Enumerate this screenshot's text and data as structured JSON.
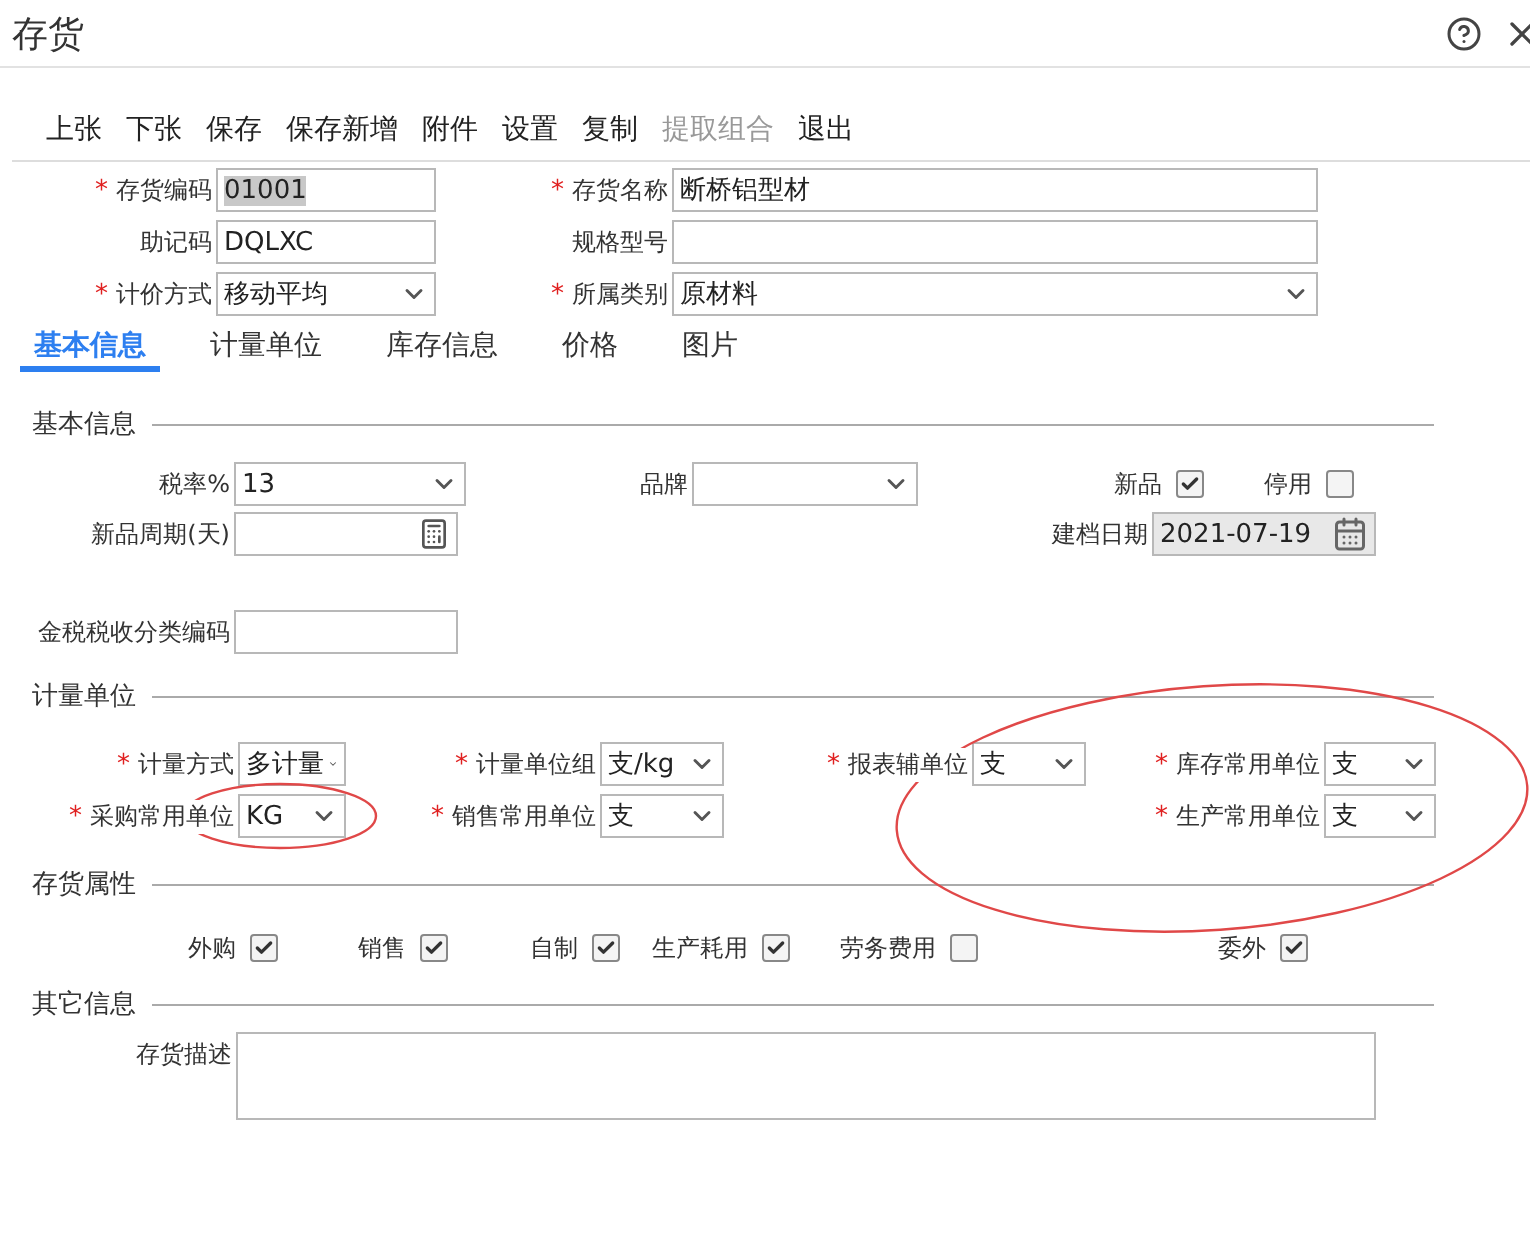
{
  "window": {
    "title": "存货"
  },
  "toolbar": [
    {
      "label": "上张",
      "disabled": false
    },
    {
      "label": "下张",
      "disabled": false
    },
    {
      "label": "保存",
      "disabled": false
    },
    {
      "label": "保存新增",
      "disabled": false
    },
    {
      "label": "附件",
      "disabled": false
    },
    {
      "label": "设置",
      "disabled": false
    },
    {
      "label": "复制",
      "disabled": false
    },
    {
      "label": "提取组合",
      "disabled": true
    },
    {
      "label": "退出",
      "disabled": false
    }
  ],
  "header_rows": [
    [
      {
        "label": "存货编码",
        "asterisk": "*",
        "kind": "text",
        "value": "01001",
        "text_selected": true
      },
      {
        "label": "存货名称",
        "asterisk": "*",
        "kind": "text",
        "value": "断桥铝型材"
      }
    ],
    [
      {
        "label": "助记码",
        "kind": "text",
        "value": "DQLXC"
      },
      {
        "label": "规格型号",
        "kind": "text"
      }
    ],
    [
      {
        "label": "计价方式",
        "asterisk": "*",
        "kind": "select",
        "value": "移动平均"
      },
      {
        "label": "所属类别",
        "asterisk": "*",
        "kind": "select",
        "value": "原材料"
      }
    ]
  ],
  "tabs": [
    {
      "label": "基本信息",
      "selected": true
    },
    {
      "label": "计量单位",
      "selected": false
    },
    {
      "label": "库存信息",
      "selected": false
    },
    {
      "label": "价格",
      "selected": false
    },
    {
      "label": "图片",
      "selected": false
    }
  ],
  "sections": [
    {
      "title": "基本信息",
      "rows": [
        [
          {
            "label": "税率%",
            "kind": "select",
            "value": "13"
          },
          {
            "label": "品牌",
            "kind": "select"
          },
          {
            "label": "新品",
            "kind": "checkbox",
            "checked": true
          },
          {
            "label": "停用",
            "kind": "checkbox",
            "checked": false
          }
        ],
        [
          {
            "label": "新品周期(天)",
            "kind": "number"
          },
          "",
          {
            "label": "建档日期",
            "kind": "date",
            "value": "2021-07-19"
          }
        ],
        [
          {
            "label": "金税税收分类编码",
            "kind": "text"
          }
        ]
      ]
    },
    {
      "title": "计量单位",
      "rows": [
        [
          {
            "label": "计量方式",
            "asterisk": "*",
            "kind": "select",
            "value": "多计量"
          },
          {
            "label": "计量单位组",
            "asterisk": "*",
            "kind": "select",
            "value": "支/kg"
          },
          {
            "label": "报表辅单位",
            "asterisk": "*",
            "kind": "select",
            "value": "支"
          },
          {
            "label": "库存常用单位",
            "asterisk": "*",
            "kind": "select",
            "value": "支"
          }
        ],
        [
          {
            "label": "采购常用单位",
            "asterisk": "*",
            "kind": "select",
            "value": "KG"
          },
          {
            "label": "销售常用单位",
            "asterisk": "*",
            "kind": "select",
            "value": "支"
          },
          "",
          {
            "label": "生产常用单位",
            "asterisk": "*",
            "kind": "select",
            "value": "支"
          }
        ]
      ]
    },
    {
      "title": "存货属性",
      "rows": [
        [
          {
            "label": "外购",
            "kind": "checkbox",
            "checked": true
          },
          {
            "label": "销售",
            "kind": "checkbox",
            "checked": true
          },
          {
            "label": "自制",
            "kind": "checkbox",
            "checked": true
          },
          {
            "label": "生产耗用",
            "kind": "checkbox",
            "checked": true
          },
          {
            "label": "劳务费用",
            "kind": "checkbox",
            "checked": false
          },
          {
            "label": "委外",
            "kind": "checkbox",
            "checked": true
          }
        ]
      ]
    },
    {
      "title": "其它信息",
      "rows": [
        [
          {
            "label": "存货描述",
            "kind": "textarea"
          }
        ]
      ]
    }
  ]
}
